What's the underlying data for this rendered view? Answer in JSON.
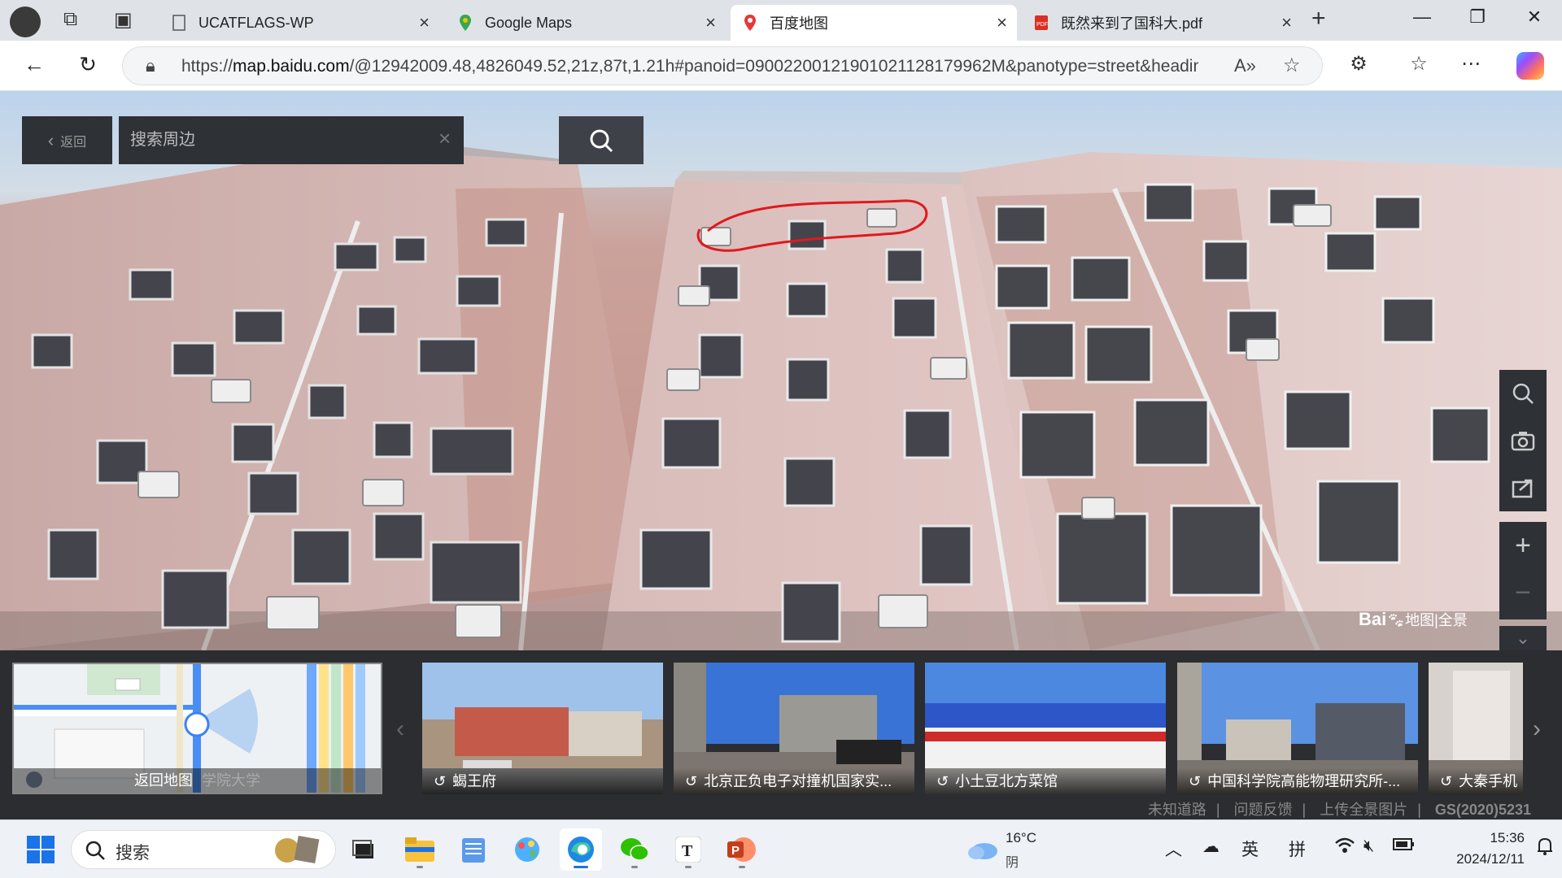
{
  "browser": {
    "tabs": [
      {
        "label": "UCATFLAGS-WP",
        "icon": "page-icon"
      },
      {
        "label": "Google Maps",
        "icon": "maps-pin-icon"
      },
      {
        "label": "百度地图",
        "icon": "baidu-pin-icon"
      },
      {
        "label": "既然来到了国科大.pdf",
        "icon": "pdf-icon"
      }
    ],
    "active_tab": 2,
    "url_prefix": "https://",
    "url_host": "map.baidu.com",
    "url_rest": "/@12942009.48,4826049.52,21z,87t,1.21h#panoid=09002200121901021128179962M&panotype=street&headin..."
  },
  "panorama": {
    "back_label": "返回",
    "search_placeholder": "搜索周边",
    "watermark_brand": "Bai",
    "watermark_text": "地图|全景",
    "tools": [
      "search-icon",
      "camera-icon",
      "share-icon",
      "zoom-in-icon",
      "zoom-out-icon",
      "collapse-icon"
    ]
  },
  "bottom": {
    "minimap_label": "返回地图",
    "minimap_bg_text": "学院大学",
    "thumbs": [
      {
        "label": "蝎王府"
      },
      {
        "label": "北京正负电子对撞机国家实..."
      },
      {
        "label": "小土豆北方菜馆"
      },
      {
        "label": "中国科学院高能物理研究所-..."
      },
      {
        "label": "大秦手机"
      }
    ],
    "footer": [
      "未知道路",
      "问题反馈",
      "上传全景图片",
      "GS(2020)5231"
    ]
  },
  "taskbar": {
    "search_label": "搜索",
    "weather_temp": "16°C",
    "weather_desc": "阴",
    "ime_lang": "英",
    "ime_mode": "拼",
    "time": "15:36",
    "date": "2024/12/11"
  },
  "colors": {
    "building": "#dcc0bd",
    "panel_dark": "#2e3136",
    "annotation": "#e0191e"
  }
}
